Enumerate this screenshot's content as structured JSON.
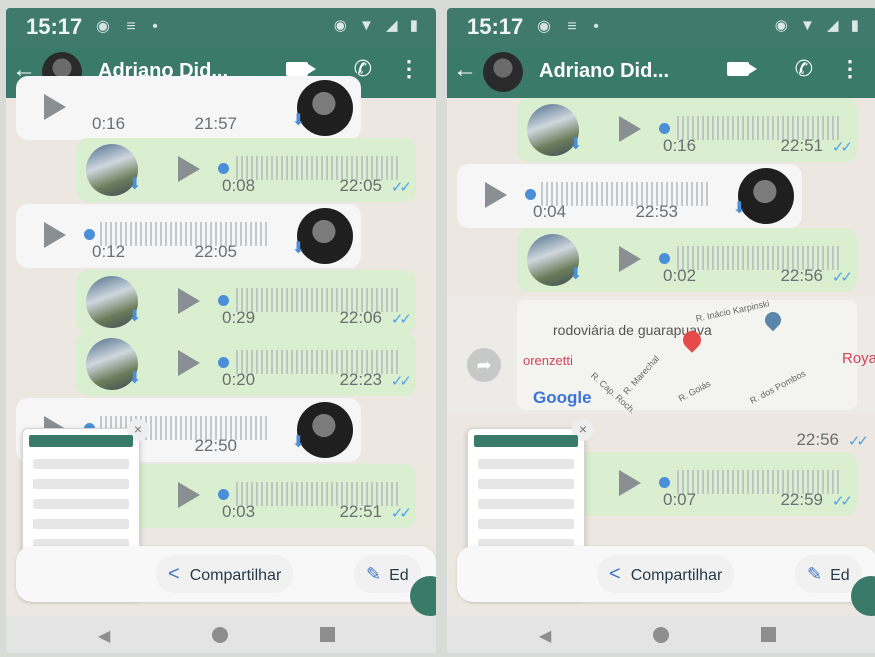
{
  "left": {
    "status": {
      "time": "15:17"
    },
    "appbar": {
      "contact": "Adriano Did..."
    },
    "messages": [
      {
        "type": "in",
        "duration": "0:16",
        "time": "21:57"
      },
      {
        "type": "out",
        "duration": "0:08",
        "time": "22:05"
      },
      {
        "type": "in",
        "duration": "0:12",
        "time": "22:05"
      },
      {
        "type": "out",
        "duration": "0:29",
        "time": "22:06"
      },
      {
        "type": "out",
        "duration": "0:20",
        "time": "22:23"
      },
      {
        "type": "in",
        "duration": "",
        "time": "22:50"
      },
      {
        "type": "out",
        "duration": "0:03",
        "time": "22:51"
      }
    ],
    "sharesheet": {
      "share_label": "Compartilhar",
      "edit_label": "Ed"
    }
  },
  "right": {
    "status": {
      "time": "15:17"
    },
    "appbar": {
      "contact": "Adriano Did..."
    },
    "messages": [
      {
        "type": "out",
        "duration": "0:16",
        "time": "22:51"
      },
      {
        "type": "in",
        "duration": "0:04",
        "time": "22:53"
      },
      {
        "type": "out",
        "duration": "0:02",
        "time": "22:56"
      },
      {
        "type": "out",
        "duration": "0:07",
        "time": "22:59"
      }
    ],
    "map": {
      "label_terminal": "rodoviária de guarapuava",
      "label_royal": "Royal",
      "label_orenzetti": "orenzetti",
      "label_google": "Google",
      "street_1": "R. Inácio Karpinski",
      "street_2": "R. Marechal",
      "street_3": "R. Cap. Roch.",
      "street_4": "R. Goiás",
      "street_5": "R. dos Pombos",
      "time": "22:56"
    },
    "sharesheet": {
      "share_label": "Compartilhar",
      "edit_label": "Ed"
    }
  }
}
